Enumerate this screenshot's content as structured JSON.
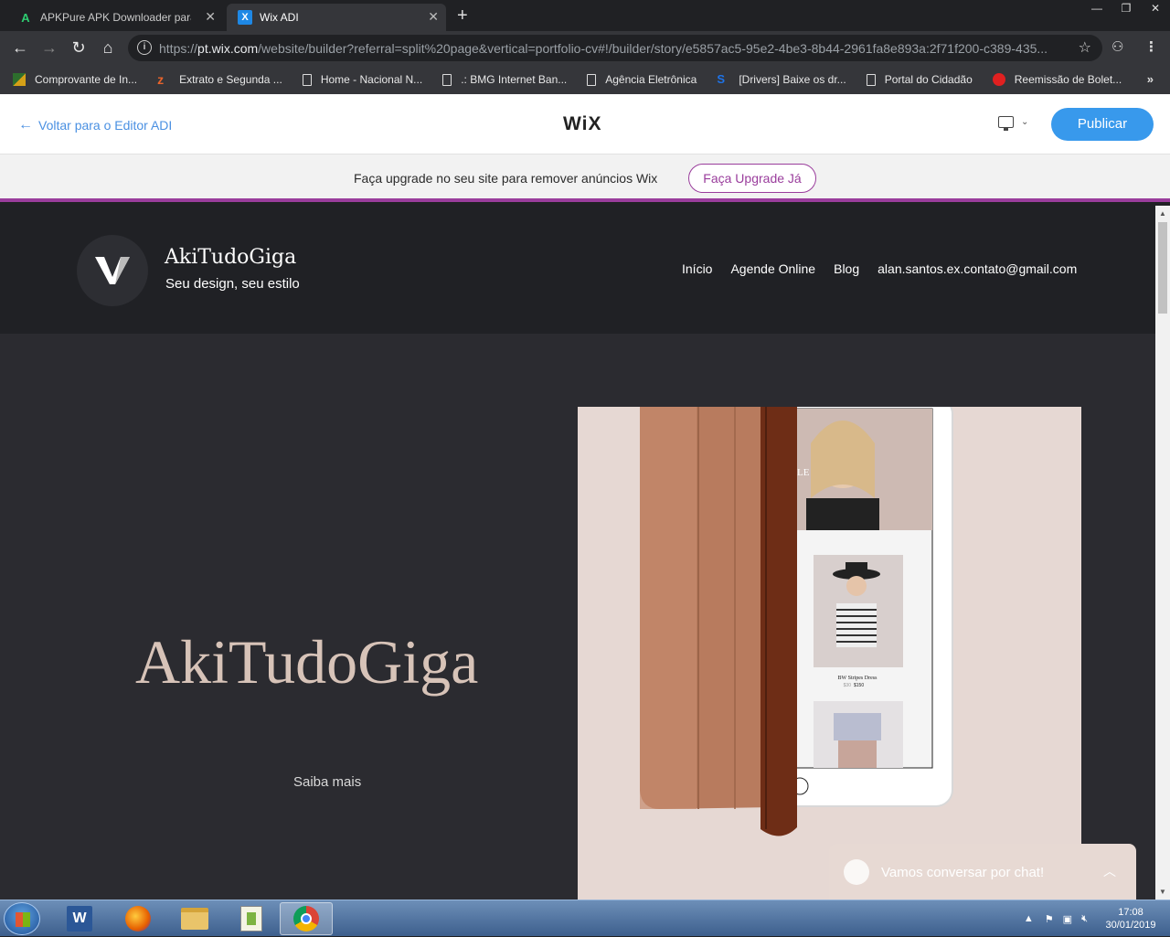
{
  "browser": {
    "tabs": [
      {
        "title": "APKPure APK Downloader para A",
        "active": false
      },
      {
        "title": "Wix ADI",
        "active": true
      }
    ],
    "url_prefix": "https://",
    "url_host": "pt.wix.com",
    "url_path": "/website/builder?referral=split%20page&vertical=portfolio-cv#!/builder/story/e5857ac5-95e2-4be3-8b44-2961fa8e893a:2f71f200-c389-435...",
    "bookmarks": [
      "Comprovante de In...",
      "Extrato e Segunda ...",
      "Home - Nacional N...",
      ".: BMG Internet Ban...",
      "Agência Eletrônica",
      "[Drivers] Baixe os dr...",
      "Portal do Cidadão",
      "Reemissão de Bolet..."
    ]
  },
  "editor": {
    "back_label": "Voltar para o Editor ADI",
    "logo": "WiX",
    "publish_label": "Publicar",
    "upgrade_message": "Faça upgrade no seu site para remover anúncios Wix",
    "upgrade_button": "Faça Upgrade Já"
  },
  "site": {
    "name": "AkiTudoGiga",
    "tagline": "Seu design, seu estilo",
    "nav": [
      "Início",
      "Agende Online",
      "Blog",
      "alan.santos.ex.contato@gmail.com"
    ],
    "hero_title": "AkiTudoGiga",
    "hero_link": "Saiba mais",
    "product_caption": "BW Stripes Dress",
    "product_price_old": "$30",
    "product_price": "$150",
    "magazine_letters": "LE"
  },
  "chat": {
    "label": "Vamos conversar por chat!"
  },
  "taskbar": {
    "time": "17:08",
    "date": "30/01/2019"
  },
  "colors": {
    "publish": "#3899ec",
    "upgrade_accent": "#9a3d9c",
    "site_bg": "#2b2b30",
    "hero_title": "#d7c3b8"
  }
}
